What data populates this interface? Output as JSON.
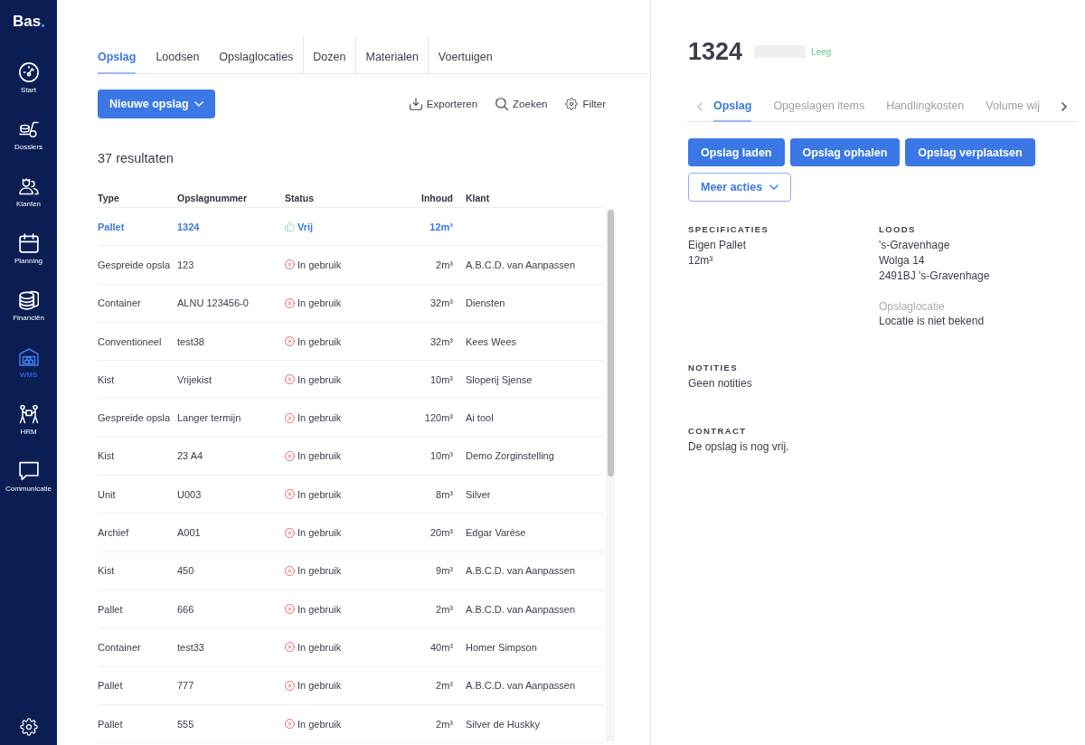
{
  "sidebar": {
    "logo": "Bas",
    "items": [
      {
        "label": "Start",
        "selected": false
      },
      {
        "label": "Dossiers",
        "selected": false
      },
      {
        "label": "Klanten",
        "selected": false
      },
      {
        "label": "Planning",
        "selected": false
      },
      {
        "label": "Financiën",
        "selected": false
      },
      {
        "label": "WMS",
        "selected": true
      },
      {
        "label": "HRM",
        "selected": false
      },
      {
        "label": "Communicatie",
        "selected": false
      }
    ]
  },
  "tabs": [
    {
      "label": "Opslag",
      "selected": true
    },
    {
      "label": "Loodsen",
      "selected": false
    },
    {
      "label": "Opslaglocaties",
      "selected": false
    },
    {
      "label": "Dozen",
      "selected": false
    },
    {
      "label": "Materialen",
      "selected": false
    },
    {
      "label": "Voertuigen",
      "selected": false
    }
  ],
  "toolbar": {
    "primary_button": "Nieuwe opslag",
    "actions": [
      "Exporteren",
      "Zoeken",
      "Filter"
    ]
  },
  "results_count": "37 resultaten",
  "table": {
    "columns": [
      "Type",
      "Opslagnummer",
      "Status",
      "Inhoud",
      "Klant"
    ],
    "rows": [
      {
        "type": "Pallet",
        "number": "1324",
        "status": {
          "kind": "free",
          "label": "Vrij"
        },
        "content": "12m³",
        "selected": true
      },
      {
        "type": "Gespreide opsla",
        "number": "123",
        "status": {
          "kind": "in_use",
          "label": "In gebruik"
        },
        "content": "2m³",
        "customer": "A.B.C.D. van Aanpassen",
        "selected": false
      },
      {
        "type": "Container",
        "number": "ALNU 123456-0",
        "status": {
          "kind": "in_use",
          "label": "In gebruik"
        },
        "content": "32m³",
        "customer": "Diensten",
        "selected": false
      },
      {
        "type": "Conventioneel",
        "number": "test38",
        "status": {
          "kind": "in_use",
          "label": "In gebruik"
        },
        "content": "32m³",
        "customer": "Kees Wees",
        "selected": false
      },
      {
        "type": "Kist",
        "number": "Vrijekist",
        "status": {
          "kind": "in_use",
          "label": "In gebruik"
        },
        "content": "10m³",
        "customer": "Sloperij Sjense",
        "selected": false
      },
      {
        "type": "Gespreide opsla",
        "number": "Langer termijn",
        "status": {
          "kind": "in_use",
          "label": "In gebruik"
        },
        "content": "120m³",
        "customer": "Ai tool",
        "selected": false
      },
      {
        "type": "Kist",
        "number": "23 A4",
        "status": {
          "kind": "in_use",
          "label": "In gebruik"
        },
        "content": "10m³",
        "customer": "Demo Zorginstelling",
        "selected": false
      },
      {
        "type": "Unit",
        "number": "U003",
        "status": {
          "kind": "in_use",
          "label": "In gebruik"
        },
        "content": "8m³",
        "customer": "Silver",
        "selected": false
      },
      {
        "type": "Archief",
        "number": "A001",
        "status": {
          "kind": "in_use",
          "label": "In gebruik"
        },
        "content": "20m³",
        "customer": "Edgar Varèse",
        "selected": false
      },
      {
        "type": "Kist",
        "number": "450",
        "status": {
          "kind": "in_use",
          "label": "In gebruik"
        },
        "content": "9m³",
        "customer": "A.B.C.D. van Aanpassen",
        "selected": false
      },
      {
        "type": "Pallet",
        "number": "666",
        "status": {
          "kind": "in_use",
          "label": "In gebruik"
        },
        "content": "2m³",
        "customer": "A.B.C.D. van Aanpassen",
        "selected": false
      },
      {
        "type": "Container",
        "number": "test33",
        "status": {
          "kind": "in_use",
          "label": "In gebruik"
        },
        "content": "40m³",
        "customer": "Homer Simpson",
        "selected": false
      },
      {
        "type": "Pallet",
        "number": "777",
        "status": {
          "kind": "in_use",
          "label": "In gebruik"
        },
        "content": "2m³",
        "customer": "A.B.C.D. van Aanpassen",
        "selected": false
      },
      {
        "type": "Pallet",
        "number": "555",
        "status": {
          "kind": "in_use",
          "label": "In gebruik"
        },
        "content": "2m³",
        "customer": "Silver de Huskky",
        "selected": false
      }
    ]
  },
  "detail": {
    "title": "1324",
    "status": "Leeg",
    "tabs": [
      {
        "label": "Opslag",
        "selected": true
      },
      {
        "label": "Opgeslagen items",
        "selected": false
      },
      {
        "label": "Handlingkosten",
        "selected": false
      },
      {
        "label": "Volume wij",
        "selected": false
      }
    ],
    "actions": [
      "Opslag laden",
      "Opslag ophalen",
      "Opslag verplaatsen"
    ],
    "more_actions": "Meer acties",
    "sections": [
      {
        "heading": "SPECIFICATIES",
        "lines": [
          "Eigen Pallet",
          "12m³"
        ]
      },
      {
        "heading": "LOODS",
        "lines": [
          "'s-Gravenhage",
          "Wolga 14",
          "2491BJ 's-Gravenhage"
        ],
        "extra": {
          "label": "Opslaglocatie",
          "value": "Locatie is niet bekend"
        }
      },
      {
        "heading": "NOTITIES",
        "lines": [
          "Geen notities"
        ]
      },
      {
        "heading": "CONTRACT",
        "lines": [
          "De opslag is nog vrij."
        ]
      }
    ]
  }
}
